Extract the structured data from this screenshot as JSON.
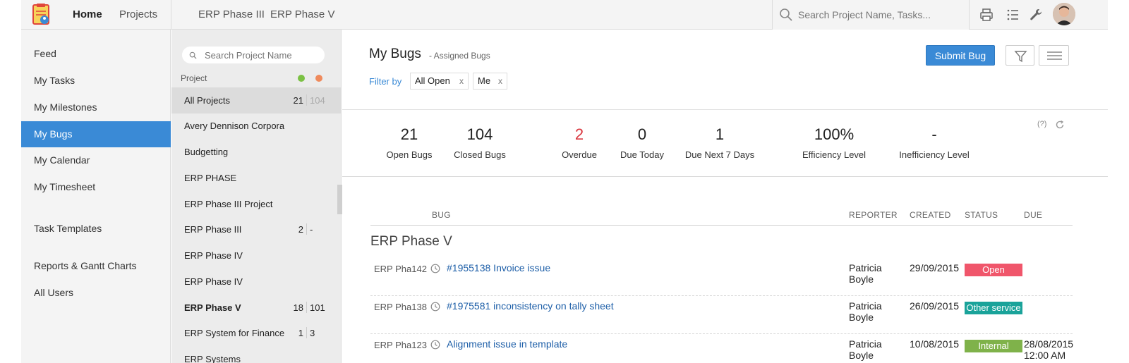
{
  "topbar": {
    "home": "Home",
    "projects": "Projects",
    "recent": [
      "ERP Phase III",
      "ERP Phase V"
    ],
    "search_placeholder": "Search Project Name, Tasks..."
  },
  "sidebar": {
    "items": [
      {
        "label": "Feed"
      },
      {
        "label": "My Tasks"
      },
      {
        "label": "My Milestones"
      },
      {
        "label": "My Bugs",
        "active": true
      },
      {
        "label": "My Calendar"
      },
      {
        "label": "My Timesheet"
      },
      {
        "label": "Task Templates"
      },
      {
        "label": "Reports & Gantt Charts"
      },
      {
        "label": "All Users"
      }
    ]
  },
  "projects": {
    "search_placeholder": "Search Project Name",
    "header": "Project",
    "rows": [
      {
        "name": "All Projects",
        "open": "21",
        "closed": "104"
      },
      {
        "name": "Avery Dennison Corporation",
        "open": "",
        "closed": ""
      },
      {
        "name": "Budgetting",
        "open": "",
        "closed": ""
      },
      {
        "name": "ERP PHASE",
        "open": "",
        "closed": ""
      },
      {
        "name": "ERP Phase III Project",
        "open": "",
        "closed": ""
      },
      {
        "name": "ERP Phase III",
        "open": "2",
        "closed": "-"
      },
      {
        "name": "ERP Phase IV",
        "open": "",
        "closed": ""
      },
      {
        "name": "ERP Phase IV",
        "open": "",
        "closed": ""
      },
      {
        "name": "ERP Phase V",
        "open": "18",
        "closed": "101"
      },
      {
        "name": "ERP System for Finance",
        "open": "1",
        "closed": "3"
      },
      {
        "name": "ERP Systems",
        "open": "",
        "closed": ""
      }
    ]
  },
  "main": {
    "title": "My Bugs",
    "subtitle": "- Assigned Bugs",
    "filter_label": "Filter by",
    "filters": [
      "All Open",
      "Me"
    ],
    "chip_close": "x",
    "submit_button": "Submit Bug",
    "help": "(?)",
    "stats": [
      {
        "value": "21",
        "label": "Open Bugs"
      },
      {
        "value": "104",
        "label": "Closed Bugs"
      },
      {
        "value": "2",
        "label": "Overdue"
      },
      {
        "value": "0",
        "label": "Due Today"
      },
      {
        "value": "1",
        "label": "Due Next 7 Days"
      },
      {
        "value": "100%",
        "label": "Efficiency Level"
      },
      {
        "value": "-",
        "label": "Inefficiency Level"
      }
    ],
    "columns": {
      "bug": "BUG",
      "reporter": "REPORTER",
      "created": "CREATED",
      "status": "STATUS",
      "due": "DUE"
    },
    "group": "ERP Phase V",
    "bugs": [
      {
        "key": "ERP Pha142",
        "title": "#1955138 Invoice issue",
        "reporter": "Patricia Boyle",
        "created": "29/09/2015",
        "status": "Open",
        "status_color": "#f0566b",
        "due": ""
      },
      {
        "key": "ERP Pha138",
        "title": "#1975581 inconsistency on tally sheet",
        "reporter": "Patricia Boyle",
        "created": "26/09/2015",
        "status": "Other service",
        "status_color": "#1aa39a",
        "due": ""
      },
      {
        "key": "ERP Pha123",
        "title": "Alignment issue in template",
        "reporter": "Patricia Boyle",
        "created": "10/08/2015",
        "status": "Internal",
        "status_color": "#7fb24a",
        "due": "28/08/2015 12:00 AM"
      }
    ]
  },
  "colors": {
    "accent": "#3a8ad6",
    "overdue": "#d9363e"
  }
}
